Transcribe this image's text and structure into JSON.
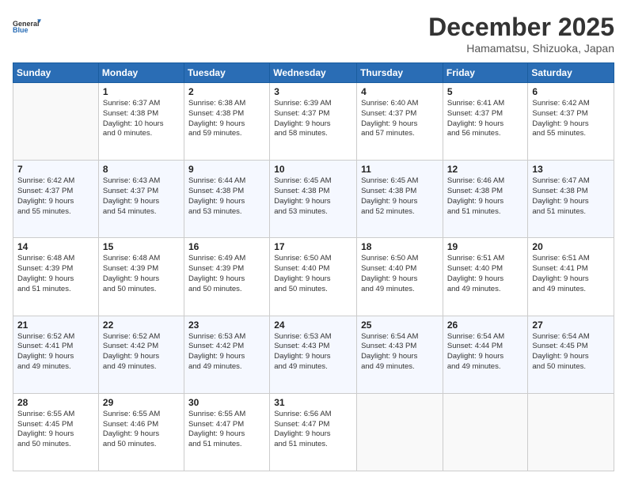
{
  "logo": {
    "line1": "General",
    "line2": "Blue"
  },
  "title": "December 2025",
  "subtitle": "Hamamatsu, Shizuoka, Japan",
  "header_days": [
    "Sunday",
    "Monday",
    "Tuesday",
    "Wednesday",
    "Thursday",
    "Friday",
    "Saturday"
  ],
  "weeks": [
    [
      {
        "day": "",
        "detail": ""
      },
      {
        "day": "1",
        "detail": "Sunrise: 6:37 AM\nSunset: 4:38 PM\nDaylight: 10 hours\nand 0 minutes."
      },
      {
        "day": "2",
        "detail": "Sunrise: 6:38 AM\nSunset: 4:38 PM\nDaylight: 9 hours\nand 59 minutes."
      },
      {
        "day": "3",
        "detail": "Sunrise: 6:39 AM\nSunset: 4:37 PM\nDaylight: 9 hours\nand 58 minutes."
      },
      {
        "day": "4",
        "detail": "Sunrise: 6:40 AM\nSunset: 4:37 PM\nDaylight: 9 hours\nand 57 minutes."
      },
      {
        "day": "5",
        "detail": "Sunrise: 6:41 AM\nSunset: 4:37 PM\nDaylight: 9 hours\nand 56 minutes."
      },
      {
        "day": "6",
        "detail": "Sunrise: 6:42 AM\nSunset: 4:37 PM\nDaylight: 9 hours\nand 55 minutes."
      }
    ],
    [
      {
        "day": "7",
        "detail": "Sunrise: 6:42 AM\nSunset: 4:37 PM\nDaylight: 9 hours\nand 55 minutes."
      },
      {
        "day": "8",
        "detail": "Sunrise: 6:43 AM\nSunset: 4:37 PM\nDaylight: 9 hours\nand 54 minutes."
      },
      {
        "day": "9",
        "detail": "Sunrise: 6:44 AM\nSunset: 4:38 PM\nDaylight: 9 hours\nand 53 minutes."
      },
      {
        "day": "10",
        "detail": "Sunrise: 6:45 AM\nSunset: 4:38 PM\nDaylight: 9 hours\nand 53 minutes."
      },
      {
        "day": "11",
        "detail": "Sunrise: 6:45 AM\nSunset: 4:38 PM\nDaylight: 9 hours\nand 52 minutes."
      },
      {
        "day": "12",
        "detail": "Sunrise: 6:46 AM\nSunset: 4:38 PM\nDaylight: 9 hours\nand 51 minutes."
      },
      {
        "day": "13",
        "detail": "Sunrise: 6:47 AM\nSunset: 4:38 PM\nDaylight: 9 hours\nand 51 minutes."
      }
    ],
    [
      {
        "day": "14",
        "detail": "Sunrise: 6:48 AM\nSunset: 4:39 PM\nDaylight: 9 hours\nand 51 minutes."
      },
      {
        "day": "15",
        "detail": "Sunrise: 6:48 AM\nSunset: 4:39 PM\nDaylight: 9 hours\nand 50 minutes."
      },
      {
        "day": "16",
        "detail": "Sunrise: 6:49 AM\nSunset: 4:39 PM\nDaylight: 9 hours\nand 50 minutes."
      },
      {
        "day": "17",
        "detail": "Sunrise: 6:50 AM\nSunset: 4:40 PM\nDaylight: 9 hours\nand 50 minutes."
      },
      {
        "day": "18",
        "detail": "Sunrise: 6:50 AM\nSunset: 4:40 PM\nDaylight: 9 hours\nand 49 minutes."
      },
      {
        "day": "19",
        "detail": "Sunrise: 6:51 AM\nSunset: 4:40 PM\nDaylight: 9 hours\nand 49 minutes."
      },
      {
        "day": "20",
        "detail": "Sunrise: 6:51 AM\nSunset: 4:41 PM\nDaylight: 9 hours\nand 49 minutes."
      }
    ],
    [
      {
        "day": "21",
        "detail": "Sunrise: 6:52 AM\nSunset: 4:41 PM\nDaylight: 9 hours\nand 49 minutes."
      },
      {
        "day": "22",
        "detail": "Sunrise: 6:52 AM\nSunset: 4:42 PM\nDaylight: 9 hours\nand 49 minutes."
      },
      {
        "day": "23",
        "detail": "Sunrise: 6:53 AM\nSunset: 4:42 PM\nDaylight: 9 hours\nand 49 minutes."
      },
      {
        "day": "24",
        "detail": "Sunrise: 6:53 AM\nSunset: 4:43 PM\nDaylight: 9 hours\nand 49 minutes."
      },
      {
        "day": "25",
        "detail": "Sunrise: 6:54 AM\nSunset: 4:43 PM\nDaylight: 9 hours\nand 49 minutes."
      },
      {
        "day": "26",
        "detail": "Sunrise: 6:54 AM\nSunset: 4:44 PM\nDaylight: 9 hours\nand 49 minutes."
      },
      {
        "day": "27",
        "detail": "Sunrise: 6:54 AM\nSunset: 4:45 PM\nDaylight: 9 hours\nand 50 minutes."
      }
    ],
    [
      {
        "day": "28",
        "detail": "Sunrise: 6:55 AM\nSunset: 4:45 PM\nDaylight: 9 hours\nand 50 minutes."
      },
      {
        "day": "29",
        "detail": "Sunrise: 6:55 AM\nSunset: 4:46 PM\nDaylight: 9 hours\nand 50 minutes."
      },
      {
        "day": "30",
        "detail": "Sunrise: 6:55 AM\nSunset: 4:47 PM\nDaylight: 9 hours\nand 51 minutes."
      },
      {
        "day": "31",
        "detail": "Sunrise: 6:56 AM\nSunset: 4:47 PM\nDaylight: 9 hours\nand 51 minutes."
      },
      {
        "day": "",
        "detail": ""
      },
      {
        "day": "",
        "detail": ""
      },
      {
        "day": "",
        "detail": ""
      }
    ]
  ]
}
